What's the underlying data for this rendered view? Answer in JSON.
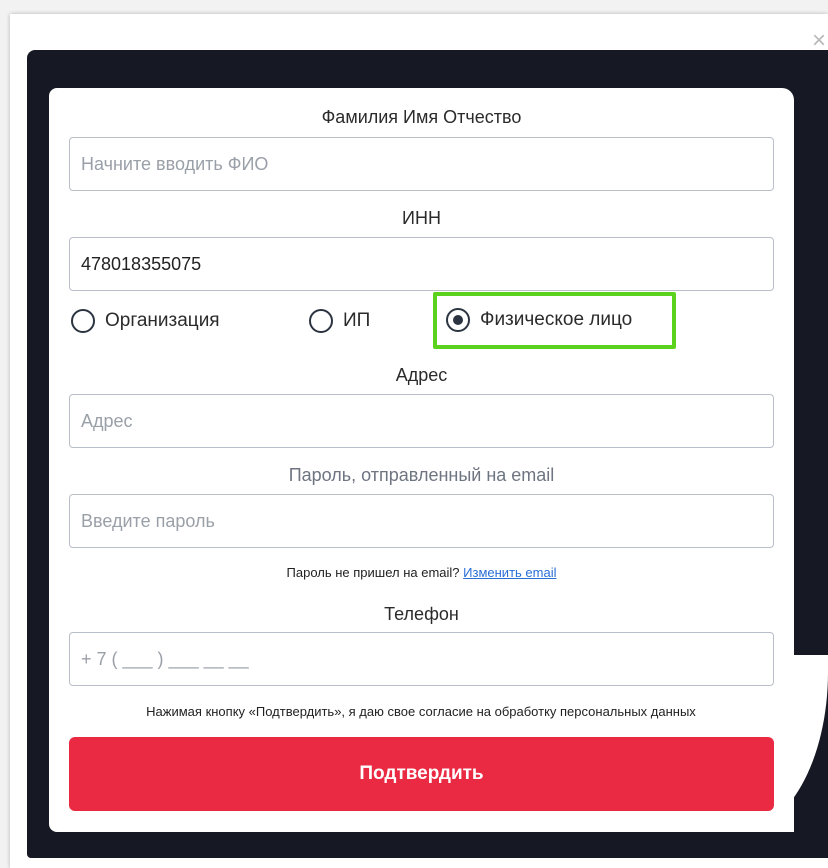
{
  "dialog": {
    "close_label": "×"
  },
  "form": {
    "fio": {
      "label": "Фамилия Имя Отчество",
      "placeholder": "Начните вводить ФИО",
      "value": ""
    },
    "inn": {
      "label": "ИНН",
      "value": "478018355075"
    },
    "entity_type": {
      "options": [
        {
          "label": "Организация",
          "selected": false
        },
        {
          "label": "ИП",
          "selected": false
        },
        {
          "label": "Физическое лицо",
          "selected": true
        }
      ]
    },
    "address": {
      "label": "Адрес",
      "placeholder": "Адрес",
      "value": ""
    },
    "password": {
      "label": "Пароль, отправленный на email",
      "placeholder": "Введите пароль",
      "value": "",
      "hint_text": "Пароль не пришел на email?",
      "hint_link": "Изменить email"
    },
    "phone": {
      "label": "Телефон",
      "placeholder": "+ 7 ( ___ ) ___ __ __",
      "value": ""
    },
    "consent_text": "Нажимая кнопку «Подтвердить», я даю свое согласие на обработку персональных данных",
    "submit_label": "Подтвердить"
  },
  "colors": {
    "frame": "#161924",
    "submit": "#ea2a42",
    "highlight": "#5bd31e",
    "link": "#2a6fd6"
  }
}
